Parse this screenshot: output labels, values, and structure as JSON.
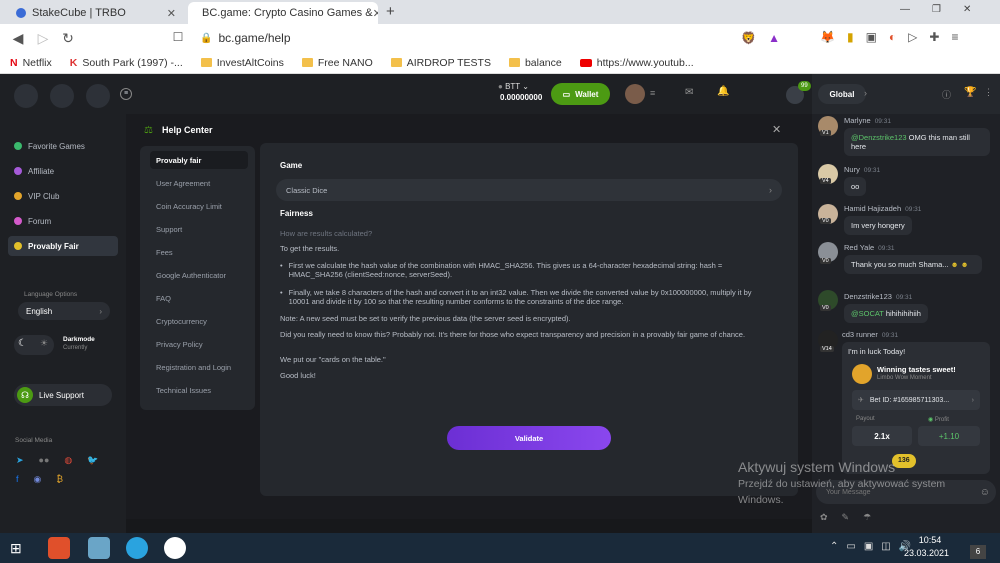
{
  "browser": {
    "tabs": [
      {
        "label": "StakeCube | TRBO"
      },
      {
        "label": "BC.game: Crypto Casino Games &"
      }
    ],
    "new_tab": "+",
    "url": "bc.game/help",
    "bookmarks": [
      "Netflix",
      "South Park (1997) -...",
      "InvestAltCoins",
      "Free NANO",
      "AIRDROP TESTS",
      "balance",
      "https://www.youtub..."
    ]
  },
  "topnav": {
    "currency": "BTT",
    "balance": "0.00000000",
    "wallet_label": "Wallet",
    "notif_count": "99"
  },
  "sidebar": {
    "items": [
      {
        "label": "Favorite Games"
      },
      {
        "label": "Affiliate"
      },
      {
        "label": "VIP Club"
      },
      {
        "label": "Forum"
      },
      {
        "label": "Provably Fair"
      }
    ],
    "language_label": "Language Options",
    "language_value": "English",
    "darkmode_label": "Darkmode",
    "darkmode_sub": "Currently",
    "live_support": "Live Support",
    "social_label": "Social Media"
  },
  "help": {
    "title": "Help Center",
    "menu": [
      "Provably fair",
      "User Agreement",
      "Coin Accuracy Limit",
      "Support",
      "Fees",
      "Google Authenticator",
      "FAQ",
      "Cryptocurrency",
      "Privacy Policy",
      "Registration and Login",
      "Technical Issues"
    ],
    "game_label": "Game",
    "game_value": "Classic Dice",
    "fairness_label": "Fairness",
    "question": "How are results calculated?",
    "intro": "To get the results.",
    "bullet1": "First we calculate the hash value of the combination with HMAC_SHA256. This gives us a 64-character hexadecimal string: hash = HMAC_SHA256 (clientSeed:nonce, serverSeed).",
    "bullet2": "Finally, we take 8 characters of the hash and convert it to an int32 value. Then we divide the converted value by 0x100000000, multiply it by 10001 and divide it by 100 so that the resulting number conforms to the constraints of the dice range.",
    "note": "Note: A new seed must be set to verify the previous data (the server seed is encrypted).",
    "p1": "Did you really need to know this? Probably not. It's there for those who expect transparency and precision in a provably fair game of chance.",
    "p2": "We put our \"cards on the table.\"",
    "p3": "Good luck!",
    "validate": "Validate"
  },
  "chat": {
    "tab": "Global",
    "messages": [
      {
        "name": "Marlyne",
        "time": "09:31",
        "level": "V1",
        "mention": "@Denzstrike123",
        "text": " OMG this man still here"
      },
      {
        "name": "Nury",
        "time": "09:31",
        "level": "V4",
        "mention": "",
        "text": "oo"
      },
      {
        "name": "Hamid Hajizadeh",
        "time": "09:31",
        "level": "V0",
        "mention": "",
        "text": "Im very hongery"
      },
      {
        "name": "Red Yale",
        "time": "09:31",
        "level": "V0",
        "mention": "",
        "text": "Thank you so much Shama..."
      },
      {
        "name": "Denzstrike123",
        "time": "09:31",
        "level": "V0",
        "mention": "@SOCAT",
        "text": " hihihihihiih"
      },
      {
        "name": "cd3 runner",
        "time": "09:31",
        "level": "V14",
        "mention": "",
        "text": "I'm in luck Today!"
      }
    ],
    "win_title": "Winning tastes sweet!",
    "win_sub": "Limbo Wow Moment",
    "bet_id": "Bet ID: #165985711303...",
    "payout_label": "Payout",
    "profit_label": "Profit",
    "payout": "2.1x",
    "profit": "+1.10",
    "unread": "136",
    "input_placeholder": "Your Message"
  },
  "watermark": {
    "line1": "Aktywuj system Windows",
    "line2": "Przejdź do ustawień, aby aktywować system",
    "line3": "Windows."
  },
  "taskbar": {
    "time": "10:54",
    "date": "23.03.2021",
    "notif": "6"
  }
}
